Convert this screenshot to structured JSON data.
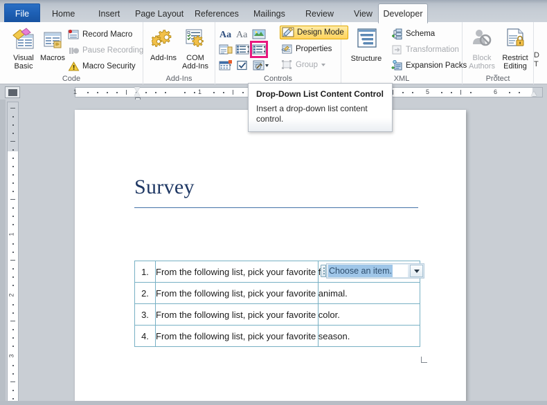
{
  "window": {
    "app": "Microsoft Word"
  },
  "tabs": [
    {
      "label": "File",
      "active": false,
      "kind": "file"
    },
    {
      "label": "Home",
      "active": false
    },
    {
      "label": "Insert",
      "active": false
    },
    {
      "label": "Page Layout",
      "active": false
    },
    {
      "label": "References",
      "active": false
    },
    {
      "label": "Mailings",
      "active": false
    },
    {
      "label": "Review",
      "active": false
    },
    {
      "label": "View",
      "active": false
    },
    {
      "label": "Developer",
      "active": true
    }
  ],
  "ribbon": {
    "groups": [
      {
        "name": "Code",
        "label": "Code"
      },
      {
        "name": "Add-Ins",
        "label": "Add-Ins"
      },
      {
        "name": "Controls",
        "label": "Controls"
      },
      {
        "name": "XML",
        "label": "XML"
      },
      {
        "name": "Protect",
        "label": "Protect"
      },
      {
        "name": "Templates",
        "label": ""
      }
    ],
    "code": {
      "visual_basic": "Visual\nBasic",
      "visual_basic_line1": "Visual",
      "visual_basic_line2": "Basic",
      "macros": "Macros",
      "record_macro": "Record Macro",
      "pause_recording": "Pause Recording",
      "macro_security": "Macro Security"
    },
    "addins": {
      "add_ins": "Add-Ins",
      "com_add_ins_line1": "COM",
      "com_add_ins_line2": "Add-Ins"
    },
    "controls": {
      "design_mode": "Design Mode",
      "properties": "Properties",
      "group": "Group",
      "icons": [
        "rich-text-content-control-icon",
        "plain-text-content-control-icon",
        "picture-content-control-icon",
        "building-block-gallery-content-control-icon",
        "combo-box-content-control-icon",
        "drop-down-list-content-control-icon",
        "date-picker-content-control-icon",
        "check-box-content-control-icon",
        "legacy-tools-icon"
      ],
      "selected_icon": "drop-down-list-content-control-icon",
      "selection_color": "#e8177d"
    },
    "xml": {
      "structure": "Structure",
      "schema": "Schema",
      "transformation": "Transformation",
      "expansion_packs": "Expansion Packs"
    },
    "protect": {
      "block_authors_line1": "Block",
      "block_authors_line2": "Authors",
      "restrict_editing_line1": "Restrict",
      "restrict_editing_line2": "Editing"
    },
    "templates": {
      "clipped_line1": "D",
      "clipped_line2": "T"
    }
  },
  "tooltip": {
    "title": "Drop-Down List Content Control",
    "body": "Insert a drop-down list content control."
  },
  "rulers": {
    "horizontal_numbers": [
      "1",
      "1",
      "5",
      "6"
    ],
    "vertical_numbers": [
      "1",
      "2",
      "3"
    ]
  },
  "document": {
    "title": "Survey",
    "table": {
      "rows": [
        {
          "num": "1.",
          "question": "From the following list, pick your favorite fruit."
        },
        {
          "num": "2.",
          "question": "From the following list, pick your favorite animal."
        },
        {
          "num": "3.",
          "question": "From the following list, pick your favorite color."
        },
        {
          "num": "4.",
          "question": "From the following list, pick your favorite season."
        }
      ]
    },
    "content_control": {
      "placeholder_text": "Choose an item.",
      "selected": true,
      "highlight_color": "#9fc6e8"
    }
  }
}
